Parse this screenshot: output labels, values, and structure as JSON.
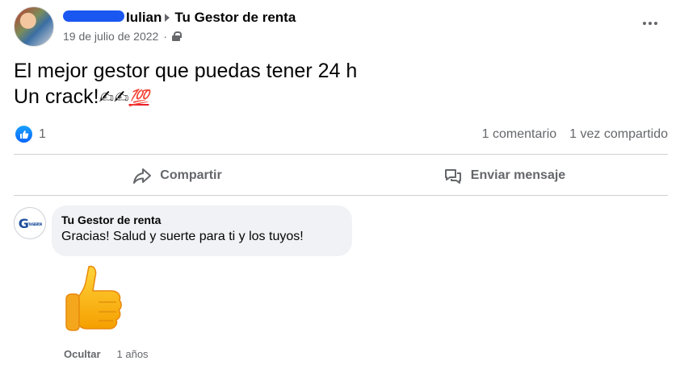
{
  "post": {
    "author_name": "Iulian",
    "target_page": "Tu Gestor de renta",
    "date": "19 de julio de 2022",
    "privacy_icon": "lock-icon",
    "more_icon": "more-options-icon",
    "text_line1": "El mejor gestor que puedas tener 24 h",
    "text_line2": "Un crack!",
    "text_emojis": "✍✍",
    "text_emoji_100": "💯"
  },
  "stats": {
    "reaction_icon": "like-icon",
    "reaction_count": "1",
    "comments": "1 comentario",
    "shares": "1 vez compartido"
  },
  "actions": {
    "share_label": "Compartir",
    "share_icon": "share-icon",
    "message_label": "Enviar mensaje",
    "message_icon": "messenger-icon"
  },
  "comment": {
    "author": "Tu Gestor de renta",
    "text": "Gracias! Salud y suerte para ti y los tuyos!",
    "avatar_logo": "G",
    "avatar_logo_sub": "TU GESTOR",
    "sticker": "thumbs-up-sticker",
    "hide_label": "Ocultar",
    "age": "1 años"
  },
  "colors": {
    "accent": "#0866ff",
    "muted_text": "#65676b",
    "bubble_bg": "#f0f2f5",
    "divider": "#ced0d4"
  }
}
